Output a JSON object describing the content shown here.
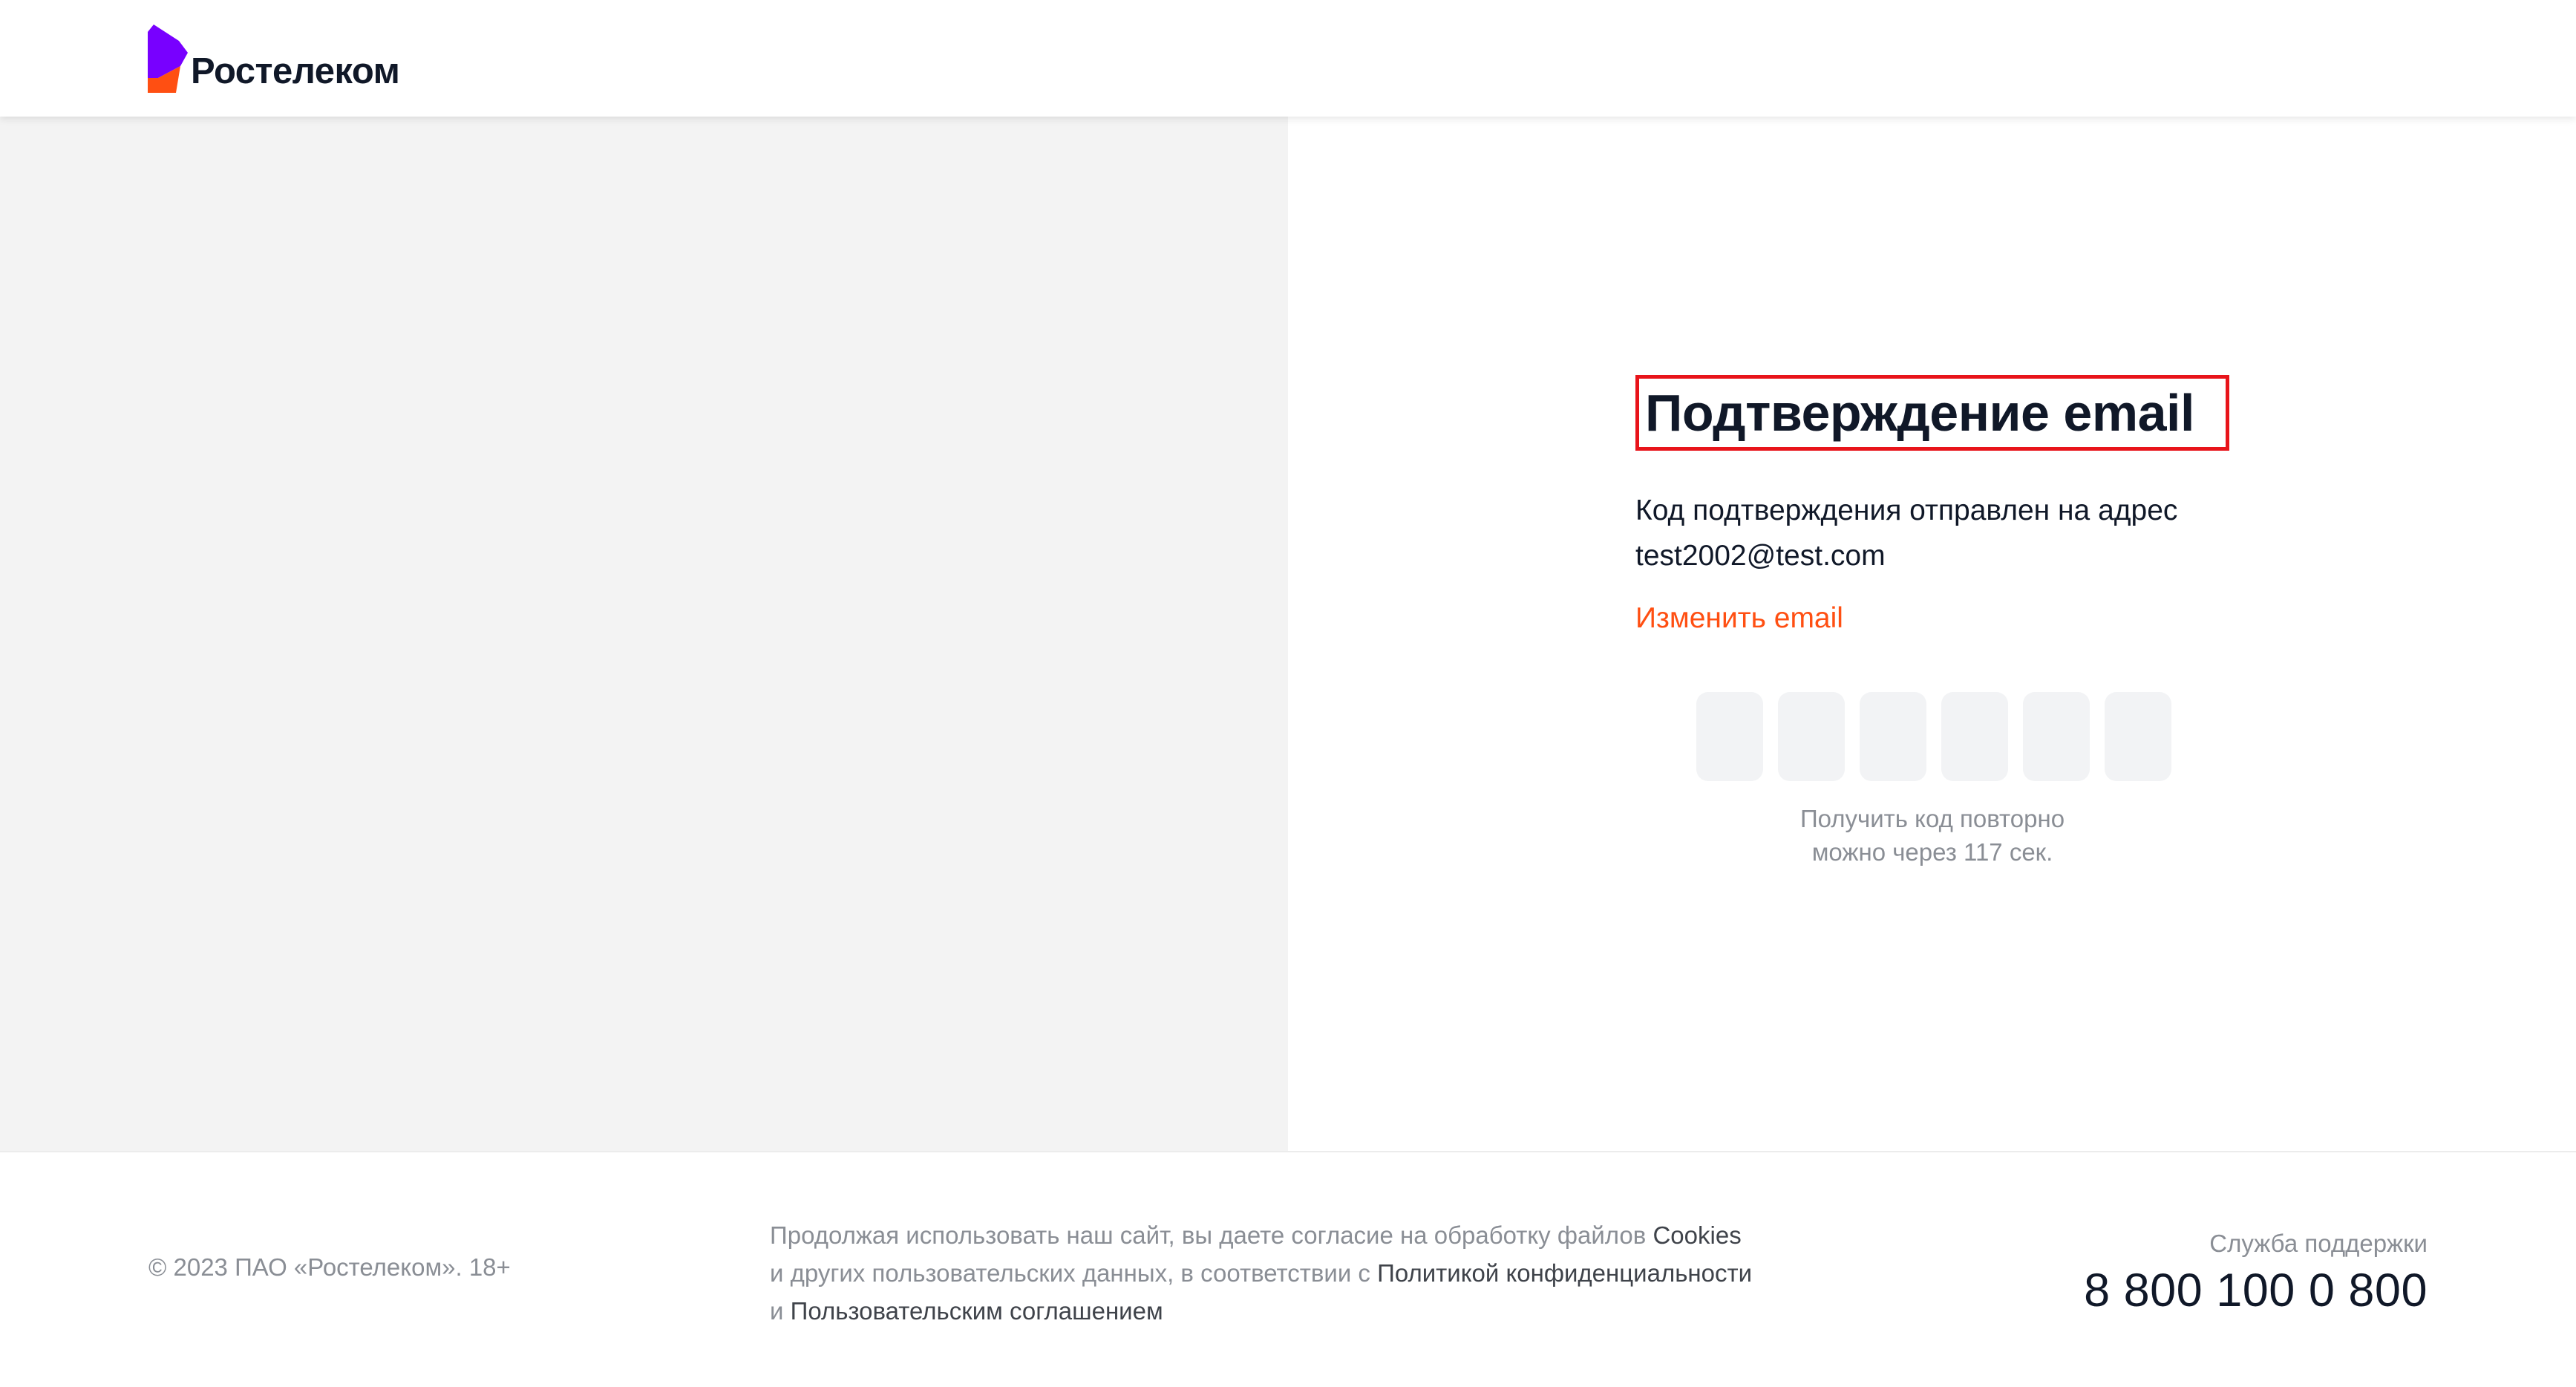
{
  "header": {
    "logo_text": "Ростелеком"
  },
  "form": {
    "title": "Подтверждение email",
    "description": "Код подтверждения отправлен на адрес",
    "email": "test2002@test.com",
    "change_email_link": "Изменить email",
    "code_cells": [
      "",
      "",
      "",
      "",
      "",
      ""
    ],
    "resend_line1": "Получить код повторно",
    "resend_line2": "можно через 117 сек."
  },
  "footer": {
    "copyright": "© 2023 ПАО «Ростелеком». 18+",
    "consent_text_1": "Продолжая использовать наш сайт, вы даете согласие на обработку файлов",
    "cookies_link": "Cookies",
    "consent_text_2": "и других пользовательских данных, в соответствии с",
    "privacy_link": "Политикой конфиденциальности",
    "consent_text_3": "и",
    "agreement_link": "Пользовательским соглашением",
    "support_label": "Служба поддержки",
    "support_phone": "8 800 100 0 800"
  },
  "colors": {
    "brand_purple": "#7800ff",
    "brand_orange": "#ff4f12",
    "highlight_frame": "#e8141a",
    "left_panel_bg": "#f3f3f3"
  },
  "icons": {
    "logo": "rostelecom-logo-icon"
  }
}
